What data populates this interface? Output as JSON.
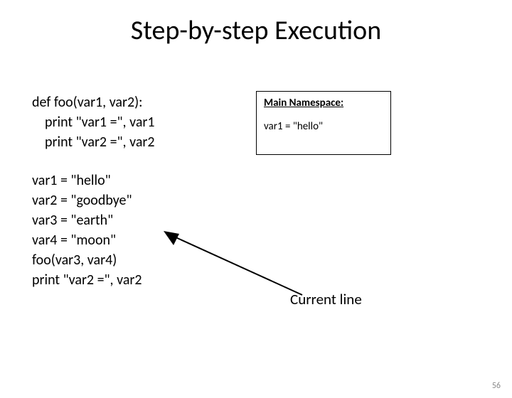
{
  "title": "Step-by-step Execution",
  "code": {
    "l1": "def foo(var1, var2):",
    "l2": "print \"var1 =\", var1",
    "l3": "print \"var2 =\", var2",
    "l4": "var1 = \"hello\"",
    "l5": "var2 = \"goodbye\"",
    "l6": "var3 = \"earth\"",
    "l7": "var4 = \"moon\"",
    "l8": "foo(var3, var4)",
    "l9": "print \"var2 =\", var2"
  },
  "namespace": {
    "title": "Main Namespace:",
    "entries": {
      "e1": "var1 = \"hello\""
    }
  },
  "current_line_label": "Current line",
  "page_number": "56"
}
